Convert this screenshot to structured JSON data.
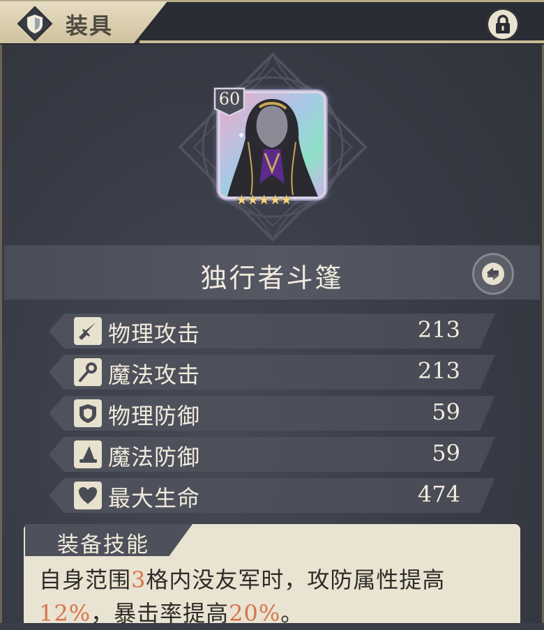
{
  "header": {
    "title": "装具"
  },
  "item": {
    "level": "60",
    "stars": "★★★★★",
    "name": "独行者斗篷"
  },
  "stats": [
    {
      "label": "物理攻击",
      "value": "213",
      "icon": "sword-icon"
    },
    {
      "label": "魔法攻击",
      "value": "213",
      "icon": "staff-icon"
    },
    {
      "label": "物理防御",
      "value": "59",
      "icon": "shield-icon"
    },
    {
      "label": "魔法防御",
      "value": "59",
      "icon": "wizard-hat-icon"
    },
    {
      "label": "最大生命",
      "value": "474",
      "icon": "heart-icon"
    }
  ],
  "skill": {
    "title": "装备技能",
    "text_parts": [
      "自身范围",
      "3",
      "格内没友军时，攻防属性提高",
      "12%",
      "，暴击率提高",
      "20%",
      "。"
    ]
  },
  "colors": {
    "highlight": "#d8744a",
    "panel": "#3a3d47",
    "tab": "#e6dcc2"
  }
}
